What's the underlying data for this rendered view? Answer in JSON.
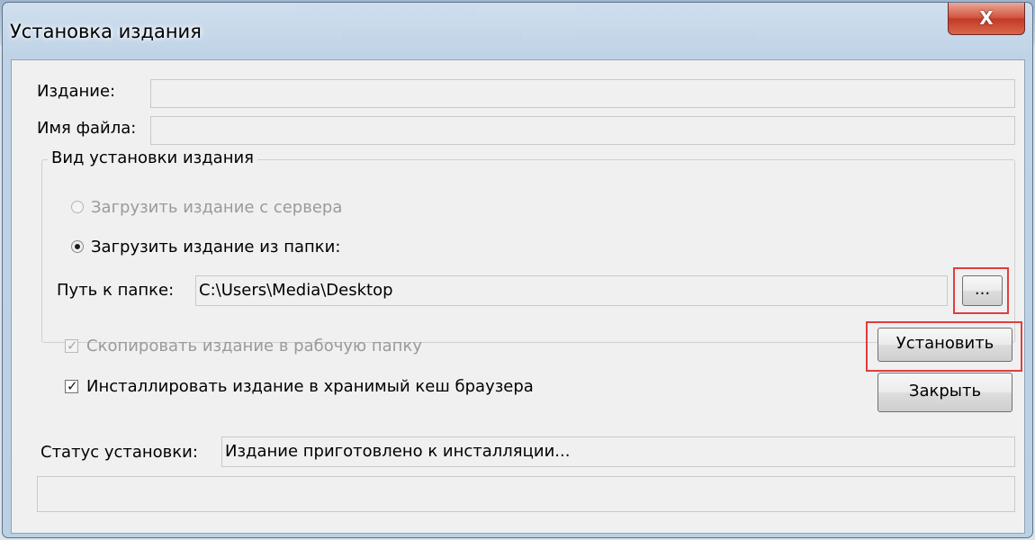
{
  "window": {
    "title": "Установка издания",
    "close_glyph": "X"
  },
  "form": {
    "edition_label": "Издание:",
    "edition_value": "",
    "filename_label": "Имя файла:",
    "filename_value": ""
  },
  "install_type": {
    "group_title": "Вид установки издания",
    "option_server_label": "Загрузить издание с сервера",
    "option_server_enabled": false,
    "option_folder_label": "Загрузить издание из папки:",
    "selected": "folder",
    "path_label": "Путь к папке:",
    "path_value": "C:\\Users\\Media\\Desktop",
    "browse_label": "..."
  },
  "options": {
    "copy_label": "Скопировать издание в рабочую папку",
    "copy_checked": true,
    "copy_enabled": false,
    "cache_label": "Инсталлировать издание в хранимый кеш браузера",
    "cache_checked": true
  },
  "buttons": {
    "install_label": "Установить",
    "close_label": "Закрыть"
  },
  "status": {
    "label": "Статус установки:",
    "value": "Издание приготовлено к инсталляции...",
    "progress": 0
  },
  "colors": {
    "highlight": "#e23d3d",
    "close_button": "#c9432e"
  }
}
